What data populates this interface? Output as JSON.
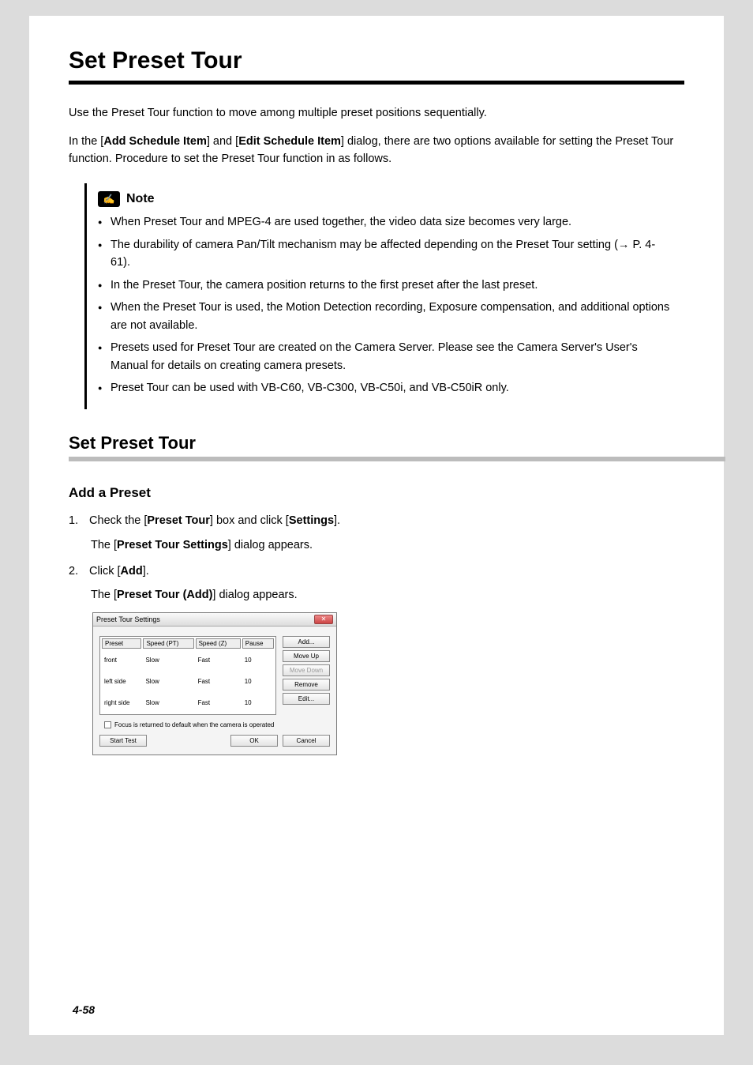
{
  "title": "Set Preset Tour",
  "intro1": "Use the Preset Tour function to move among multiple preset positions sequentially.",
  "intro2_a": "In the [",
  "intro2_b": "Add Schedule Item",
  "intro2_c": "] and [",
  "intro2_d": "Edit Schedule Item",
  "intro2_e": "] dialog, there are two options available for setting the Preset Tour function. Procedure to set the Preset Tour function in as follows.",
  "note_label": "Note",
  "notes": [
    "When Preset Tour and MPEG-4 are used together, the video data size becomes very large.",
    "The durability of camera Pan/Tilt mechanism may be affected depending on the Preset Tour setting (→ P. 4-61).",
    "In the Preset Tour, the camera position returns to the first preset after the last preset.",
    "When the Preset Tour is used, the Motion Detection recording, Exposure compensation, and additional options are not available.",
    "Presets used for Preset Tour are created on the Camera Server. Please see the Camera Server's User's Manual for details on creating camera presets.",
    "Preset Tour can be used with VB-C60, VB-C300, VB-C50i, and VB-C50iR only."
  ],
  "section": "Set Preset Tour",
  "subsection": "Add a Preset",
  "step1_num": "1.",
  "step1_a": "Check the [",
  "step1_b": "Preset Tour",
  "step1_c": "] box and click [",
  "step1_d": "Settings",
  "step1_e": "].",
  "step1_sub_a": "The [",
  "step1_sub_b": "Preset Tour Settings",
  "step1_sub_c": "] dialog appears.",
  "step2_num": "2.",
  "step2_a": "Click [",
  "step2_b": "Add",
  "step2_c": "].",
  "step2_sub_a": "The [",
  "step2_sub_b": "Preset Tour (Add)",
  "step2_sub_c": "] dialog appears.",
  "dialog": {
    "title": "Preset Tour Settings",
    "headers": [
      "Preset",
      "Speed (PT)",
      "Speed (Z)",
      "Pause"
    ],
    "rows": [
      [
        "front",
        "Slow",
        "Fast",
        "10"
      ],
      [
        "left side",
        "Slow",
        "Fast",
        "10"
      ],
      [
        "right side",
        "Slow",
        "Fast",
        "10"
      ]
    ],
    "buttons": {
      "add": "Add...",
      "moveup": "Move Up",
      "movedown": "Move Down",
      "remove": "Remove",
      "edit": "Edit..."
    },
    "checkbox": "Focus is returned to default when the camera is operated",
    "starttest": "Start Test",
    "ok": "OK",
    "cancel": "Cancel"
  },
  "page_number": "4-58"
}
